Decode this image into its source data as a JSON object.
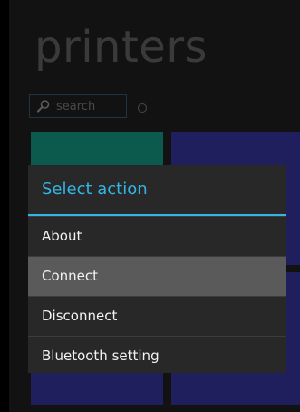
{
  "app": {
    "title": "printers"
  },
  "search": {
    "placeholder": "search"
  },
  "dialog": {
    "title": "Select action",
    "items": [
      {
        "label": "About"
      },
      {
        "label": "Connect"
      },
      {
        "label": "Disconnect"
      },
      {
        "label": "Bluetooth setting"
      }
    ],
    "selected_index": 1
  },
  "colors": {
    "accent": "#33b5e5",
    "tile_teal": "#0c5a4e",
    "tile_navy": "#1e1f5c",
    "dialog_bg": "#282828",
    "selected_bg": "#5a5a5a"
  },
  "icons": [
    "search-icon",
    "refresh-icon"
  ]
}
